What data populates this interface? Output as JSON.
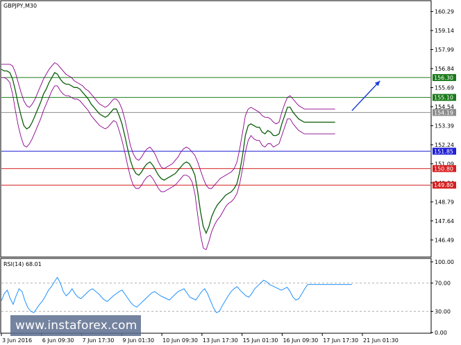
{
  "chart_data": {
    "type": "line",
    "title": "GBPJPY,M30",
    "y_ticks": [
      "160.29",
      "159.14",
      "157.99",
      "156.84",
      "155.69",
      "154.54",
      "153.39",
      "152.24",
      "151.09",
      "149.94",
      "148.79",
      "147.64",
      "146.49"
    ],
    "price_range": [
      145.5,
      160.9
    ],
    "time_labels": [
      "3 Jun 2016",
      "6 Jun 09:30",
      "7 Jun 17:30",
      "9 Jun 01:30",
      "10 Jun 09:30",
      "13 Jun 17:30",
      "15 Jun 01:30",
      "16 Jun 09:30",
      "17 Jun 17:30",
      "21 Jun 01:30"
    ],
    "price_series": {
      "name": "close",
      "x": [
        0,
        4,
        8,
        12,
        16,
        20,
        24,
        28,
        32,
        36,
        40,
        44,
        48,
        52,
        56,
        60,
        64,
        68,
        72,
        76,
        80,
        84,
        88,
        92,
        96,
        100,
        104,
        108,
        112,
        116,
        120,
        124,
        128,
        132,
        136,
        140,
        144,
        148,
        152,
        156,
        160,
        164,
        168,
        172,
        176,
        180,
        184,
        188,
        192,
        196,
        200,
        204,
        208,
        212,
        216,
        220,
        224,
        228,
        232,
        236,
        240,
        244,
        248,
        252,
        256,
        260,
        264,
        268,
        272,
        276,
        280,
        284,
        288,
        292,
        296,
        300,
        304,
        308,
        312,
        316,
        320,
        324,
        328,
        332,
        336,
        340,
        344,
        348,
        352,
        356,
        360,
        364,
        368,
        372,
        376,
        380,
        384,
        388,
        392,
        396,
        400,
        404,
        408,
        412,
        416,
        420,
        424,
        428,
        432,
        436,
        440,
        444,
        448,
        452,
        456,
        460,
        464,
        468,
        472,
        476,
        480,
        484,
        488,
        492,
        496,
        500
      ],
      "values": [
        156.8,
        156.7,
        156.7,
        156.6,
        156.2,
        155.5,
        154.7,
        154.0,
        153.4,
        153.2,
        153.3,
        153.6,
        154.0,
        154.4,
        154.8,
        155.3,
        155.6,
        156.0,
        156.3,
        156.6,
        156.5,
        156.2,
        156.0,
        155.9,
        155.9,
        155.8,
        155.7,
        155.7,
        155.6,
        155.4,
        155.2,
        155.0,
        154.7,
        154.5,
        154.3,
        154.1,
        154.0,
        153.9,
        154.0,
        154.2,
        154.4,
        154.4,
        154.0,
        153.5,
        152.8,
        152.0,
        151.3,
        150.8,
        150.5,
        150.4,
        150.6,
        150.9,
        151.1,
        151.2,
        151.0,
        150.7,
        150.4,
        150.2,
        150.1,
        150.2,
        150.3,
        150.4,
        150.5,
        150.7,
        150.9,
        151.1,
        151.2,
        151.1,
        150.8,
        150.4,
        149.4,
        148.2,
        147.3,
        146.9,
        147.3,
        147.9,
        148.3,
        148.6,
        148.8,
        149.0,
        149.2,
        149.3,
        149.4,
        149.6,
        149.9,
        150.6,
        151.6,
        152.8,
        153.4,
        153.5,
        153.4,
        153.3,
        153.3,
        153.0,
        152.9,
        153.1,
        153.0,
        152.8,
        152.8,
        152.9,
        153.5,
        154.0,
        154.5,
        154.5,
        154.2,
        154.0,
        153.8,
        153.7,
        153.6,
        153.6,
        153.6,
        153.6,
        153.6,
        153.6,
        153.6,
        153.6,
        153.6,
        153.6,
        153.6,
        153.6
      ],
      "upper_band": [
        157.1,
        157.1,
        157.1,
        157.1,
        157.0,
        156.6,
        156.0,
        155.4,
        154.9,
        154.6,
        154.5,
        154.7,
        155.0,
        155.4,
        155.8,
        156.2,
        156.5,
        156.8,
        157.0,
        157.2,
        157.1,
        156.9,
        156.7,
        156.5,
        156.4,
        156.3,
        156.1,
        156.0,
        155.9,
        155.8,
        155.6,
        155.5,
        155.3,
        155.1,
        154.9,
        154.7,
        154.6,
        154.5,
        154.6,
        154.8,
        155.0,
        155.0,
        154.8,
        154.4,
        153.8,
        153.0,
        152.2,
        151.7,
        151.4,
        151.3,
        151.5,
        151.8,
        152.0,
        152.1,
        151.9,
        151.6,
        151.2,
        150.9,
        150.8,
        150.9,
        151.0,
        151.1,
        151.3,
        151.5,
        151.8,
        152.0,
        152.1,
        152.0,
        151.8,
        151.6,
        151.2,
        150.7,
        150.2,
        149.8,
        149.6,
        149.6,
        149.8,
        150.0,
        150.2,
        150.3,
        150.4,
        150.5,
        150.6,
        150.8,
        151.2,
        152.0,
        153.0,
        154.0,
        154.4,
        154.5,
        154.4,
        154.3,
        154.2,
        154.0,
        153.9,
        153.9,
        153.8,
        153.6,
        153.5,
        153.6,
        154.2,
        154.7,
        155.1,
        155.2,
        155.0,
        154.8,
        154.6,
        154.5,
        154.4,
        154.4,
        154.4,
        154.4,
        154.4,
        154.4,
        154.4,
        154.4,
        154.4,
        154.4,
        154.4,
        154.4
      ],
      "lower_band": [
        156.3,
        156.3,
        156.2,
        156.0,
        155.3,
        154.3,
        153.4,
        152.7,
        152.2,
        152.1,
        152.3,
        152.6,
        153.0,
        153.4,
        153.8,
        154.3,
        154.7,
        155.1,
        155.5,
        155.8,
        155.8,
        155.5,
        155.3,
        155.2,
        155.2,
        155.1,
        155.0,
        155.0,
        154.9,
        154.7,
        154.5,
        154.3,
        154.0,
        153.8,
        153.6,
        153.4,
        153.3,
        153.2,
        153.3,
        153.5,
        153.7,
        153.6,
        153.1,
        152.5,
        151.8,
        151.0,
        150.3,
        149.8,
        149.6,
        149.6,
        149.8,
        150.1,
        150.3,
        150.4,
        150.2,
        149.9,
        149.6,
        149.4,
        149.4,
        149.5,
        149.6,
        149.7,
        149.8,
        150.0,
        150.2,
        150.4,
        150.4,
        150.3,
        150.0,
        149.3,
        148.0,
        146.8,
        146.0,
        145.9,
        146.4,
        147.0,
        147.4,
        147.7,
        147.9,
        148.2,
        148.5,
        148.7,
        148.8,
        149.0,
        149.3,
        149.9,
        150.8,
        151.8,
        152.5,
        152.8,
        152.6,
        152.5,
        152.5,
        152.2,
        152.1,
        152.3,
        152.3,
        152.1,
        152.2,
        152.3,
        152.8,
        153.3,
        153.8,
        153.8,
        153.5,
        153.3,
        153.1,
        153.0,
        152.9,
        152.9,
        152.9,
        152.9,
        152.9,
        152.9,
        152.9,
        152.9,
        152.9,
        152.9,
        152.9,
        152.9
      ]
    },
    "levels": [
      {
        "label": "156.30",
        "value": 156.3,
        "color": "#1a7a1a"
      },
      {
        "label": "155.10",
        "value": 155.1,
        "color": "#1a7a1a"
      },
      {
        "label": "154.19",
        "value": 154.19,
        "color": "#8c8c8c"
      },
      {
        "label": "151.85",
        "value": 151.85,
        "color": "#1f1fd6"
      },
      {
        "label": "150.80",
        "value": 150.8,
        "color": "#d61f1f"
      },
      {
        "label": "149.80",
        "value": 149.8,
        "color": "#d61f1f"
      }
    ],
    "forecast_arrow": {
      "from": {
        "x": 500,
        "value": 154.3
      },
      "to": {
        "x": 540,
        "value": 156.1
      },
      "color": "#1f3fd6"
    },
    "rsi": {
      "title": "RSI(14) 68.01",
      "range": [
        0,
        100
      ],
      "ticks": [
        "100.00",
        "70.00",
        "30.00",
        "0.00"
      ],
      "levels": [
        70,
        30
      ],
      "values": [
        45,
        55,
        60,
        48,
        40,
        52,
        62,
        58,
        45,
        35,
        30,
        28,
        34,
        40,
        45,
        52,
        60,
        65,
        72,
        78,
        70,
        58,
        52,
        56,
        62,
        55,
        50,
        48,
        52,
        56,
        60,
        62,
        58,
        55,
        50,
        46,
        44,
        48,
        52,
        55,
        58,
        60,
        54,
        48,
        42,
        38,
        36,
        40,
        44,
        48,
        52,
        56,
        58,
        55,
        52,
        50,
        48,
        46,
        50,
        54,
        58,
        60,
        62,
        56,
        50,
        48,
        46,
        52,
        58,
        62,
        55,
        45,
        35,
        28,
        30,
        38,
        45,
        52,
        58,
        62,
        65,
        60,
        56,
        52,
        50,
        55,
        62,
        66,
        70,
        74,
        72,
        68,
        66,
        64,
        62,
        60,
        62,
        64,
        58,
        50,
        46,
        48,
        55,
        62,
        68,
        68,
        68,
        68,
        68,
        68,
        68,
        68,
        68,
        68,
        68,
        68,
        68,
        68,
        68,
        68
      ],
      "color": "#1e90ff"
    }
  },
  "watermark": "www.instaforex.com"
}
